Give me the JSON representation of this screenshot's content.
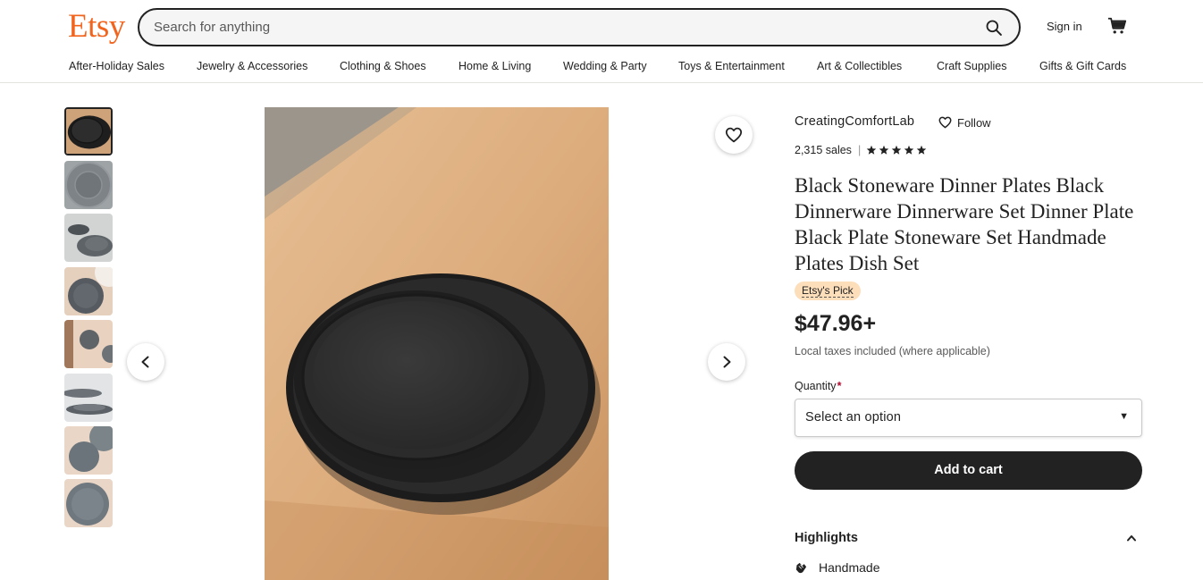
{
  "header": {
    "logo": "Etsy",
    "search_placeholder": "Search for anything",
    "sign_in": "Sign in"
  },
  "nav": {
    "items": [
      "After-Holiday Sales",
      "Jewelry & Accessories",
      "Clothing & Shoes",
      "Home & Living",
      "Wedding & Party",
      "Toys & Entertainment",
      "Art & Collectibles",
      "Craft Supplies",
      "Gifts & Gift Cards"
    ]
  },
  "gallery": {
    "thumbnail_count": 8,
    "active_index": 0
  },
  "product": {
    "shop_name": "CreatingComfortLab",
    "follow_label": "Follow",
    "sales": "2,315 sales",
    "rating_stars": 5,
    "title": "Black Stoneware Dinner Plates Black Dinnerware Dinnerware Set Dinner Plate Black Plate Stoneware Set Handmade Plates Dish Set",
    "badge": "Etsy's Pick",
    "price": "$47.96+",
    "tax_note": "Local taxes included (where applicable)",
    "quantity_label": "Quantity",
    "required_mark": "*",
    "quantity_value": "Select an option",
    "add_to_cart": "Add to cart",
    "highlights_label": "Highlights",
    "highlight_items": [
      "Handmade"
    ]
  },
  "colors": {
    "brand": "#f1641e",
    "button": "#222222",
    "badge_bg": "#fddebb",
    "required": "#b3082e"
  },
  "icons": [
    "search-icon",
    "cart-icon",
    "heart-icon",
    "star-icon",
    "chevron-left-icon",
    "chevron-right-icon",
    "caret-down-icon",
    "chevron-up-icon",
    "hand-icon"
  ]
}
